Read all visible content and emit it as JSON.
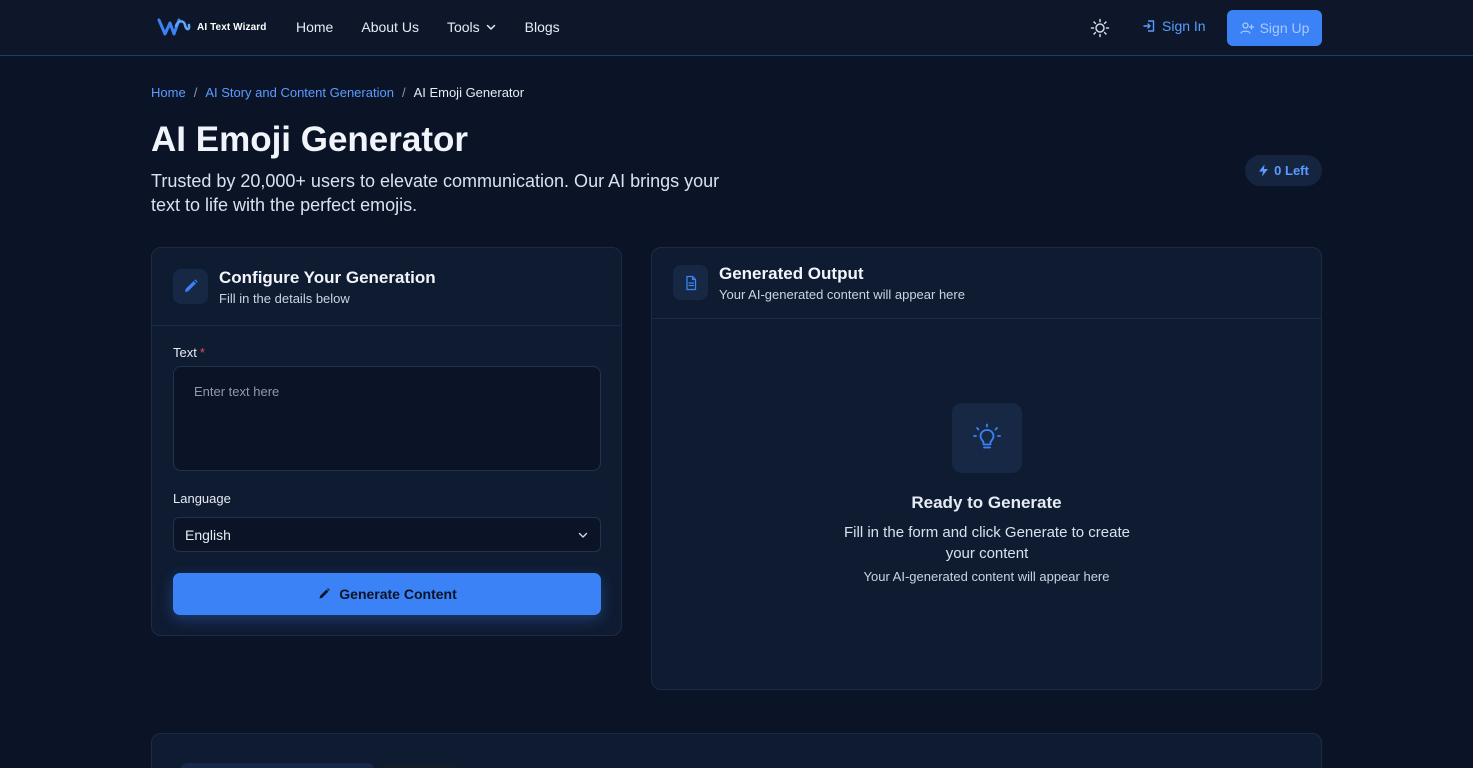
{
  "header": {
    "logo_text": "AI Text Wizard",
    "nav": [
      {
        "label": "Home"
      },
      {
        "label": "About Us"
      },
      {
        "label": "Tools"
      },
      {
        "label": "Blogs"
      }
    ],
    "sign_in_label": "Sign In",
    "sign_up_label": "Sign Up",
    "theme_icon": "sun-icon"
  },
  "breadcrumb": {
    "items": [
      "Home",
      "AI Story and Content Generation"
    ],
    "current": "AI Emoji Generator",
    "separator": "/"
  },
  "page": {
    "title": "AI Emoji Generator",
    "subtitle": "Trusted by 20,000+ users to elevate communication. Our AI brings your text to life with the perfect emojis.",
    "credits_label": "0 Left"
  },
  "config_card": {
    "title": "Configure Your Generation",
    "subtitle": "Fill in the details below",
    "text_label": "Text",
    "required_mark": "*",
    "text_placeholder": "Enter text here",
    "text_value": "",
    "language_label": "Language",
    "language_value": "English",
    "generate_label": "Generate Content"
  },
  "output_card": {
    "title": "Generated Output",
    "subtitle": "Your AI-generated content will appear here",
    "ready_title": "Ready to Generate",
    "ready_text": "Fill in the form and click Generate to create your content",
    "ready_sub": "Your AI-generated content will appear here"
  },
  "colors": {
    "accent": "#3b82f6",
    "link": "#5b9bff",
    "background": "#0b1426",
    "card": "#0f1b31"
  }
}
